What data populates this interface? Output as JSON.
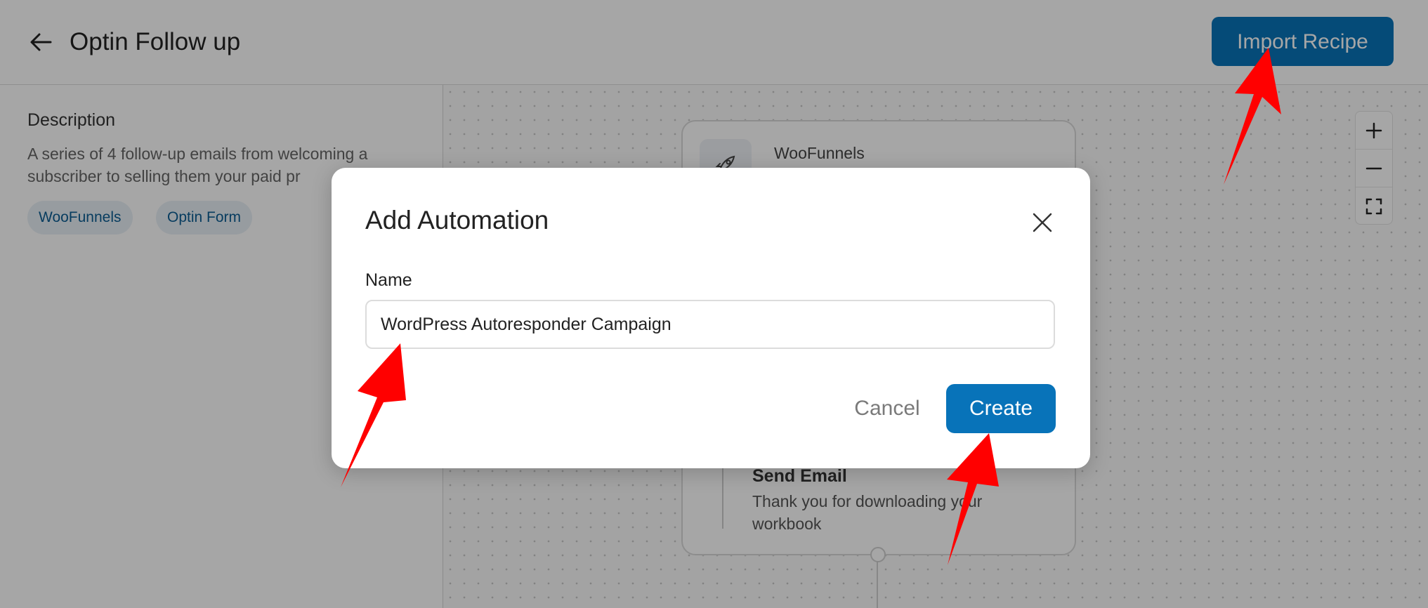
{
  "header": {
    "title": "Optin Follow up",
    "import_button": "Import Recipe"
  },
  "left_panel": {
    "description_heading": "Description",
    "description_text": "A series of 4 follow-up emails from welcoming a subscriber to selling them your paid pr",
    "tags": [
      "WooFunnels",
      "Optin Form"
    ]
  },
  "canvas": {
    "trigger_node": {
      "title": "WooFunnels"
    },
    "action_node": {
      "title": "Send Email",
      "description": "Thank you for downloading your workbook"
    }
  },
  "modal": {
    "title": "Add Automation",
    "name_label": "Name",
    "name_value": "WordPress Autoresponder Campaign",
    "cancel_label": "Cancel",
    "create_label": "Create"
  },
  "colors": {
    "primary": "#0873b9",
    "annotation_arrow": "#ff0000"
  }
}
